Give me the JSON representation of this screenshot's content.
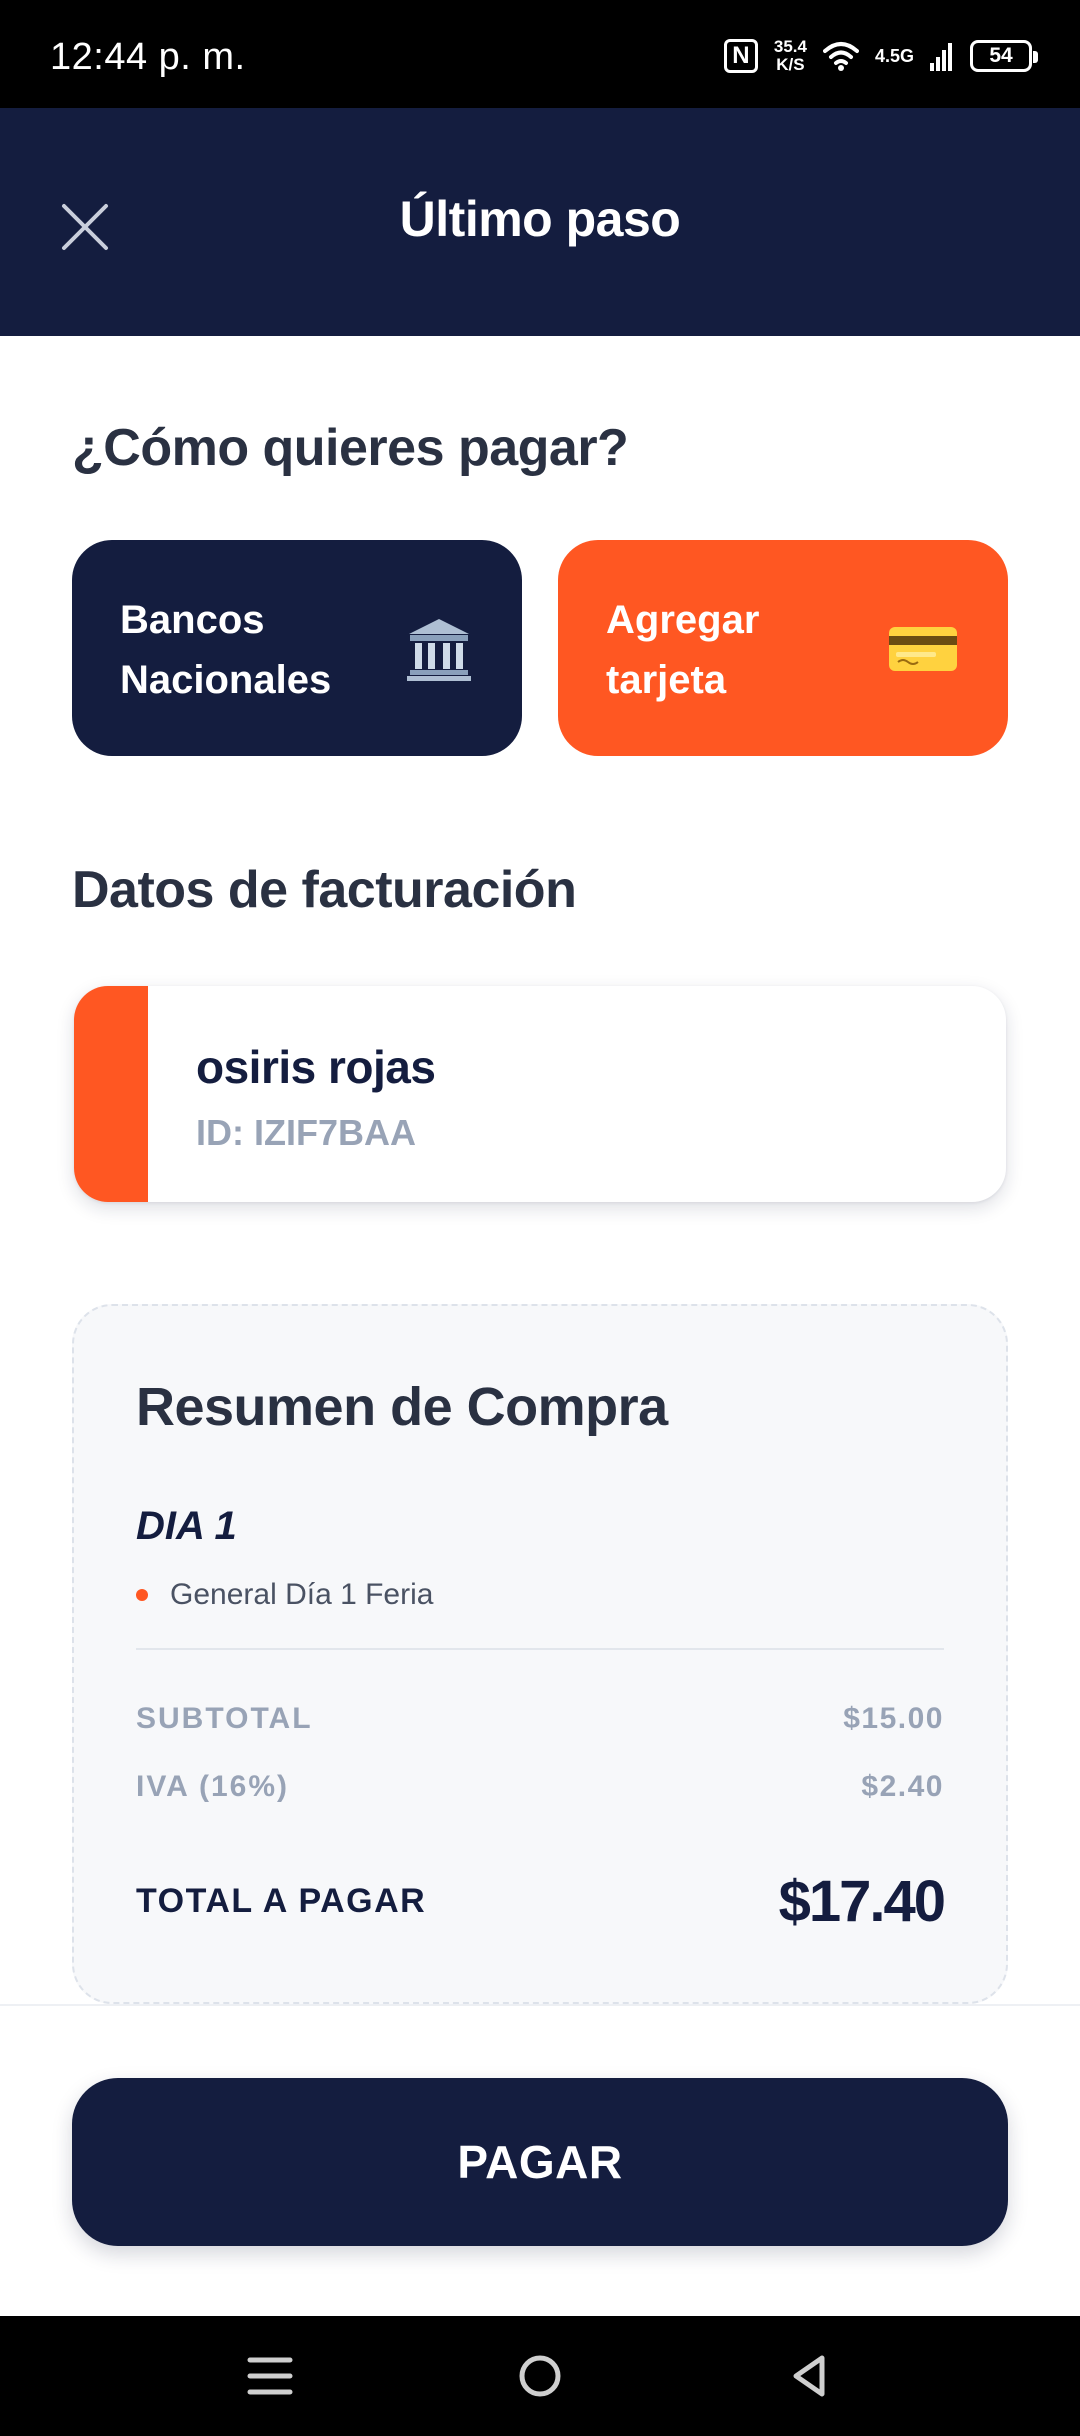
{
  "status_bar": {
    "time": "12:44 p. m.",
    "nfc_icon": "nfc-icon",
    "speed_value": "35.4",
    "speed_unit": "K/S",
    "network": "4.5G",
    "battery": "54"
  },
  "header": {
    "title": "Último paso",
    "close_icon": "close-icon"
  },
  "payment": {
    "heading": "¿Cómo quieres pagar?",
    "options": [
      {
        "label_line1": "Bancos",
        "label_line2": "Nacionales",
        "icon": "bank-icon"
      },
      {
        "label_line1": "Agregar",
        "label_line2": "tarjeta",
        "icon": "credit-card-icon"
      }
    ]
  },
  "billing": {
    "heading": "Datos de facturación",
    "name": "osiris rojas",
    "id": "ID: IZIF7BAA"
  },
  "summary": {
    "title": "Resumen de Compra",
    "day": "DIA 1",
    "item": "General Día 1 Feria",
    "subtotal_label": "SUBTOTAL",
    "subtotal_value": "$15.00",
    "iva_label": "IVA (16%)",
    "iva_value": "$2.40",
    "total_label": "TOTAL A PAGAR",
    "total_value": "$17.40"
  },
  "actions": {
    "pay_label": "PAGAR"
  },
  "colors": {
    "navy": "#141d3f",
    "accent": "#ff5722",
    "muted": "#98a3b6"
  }
}
